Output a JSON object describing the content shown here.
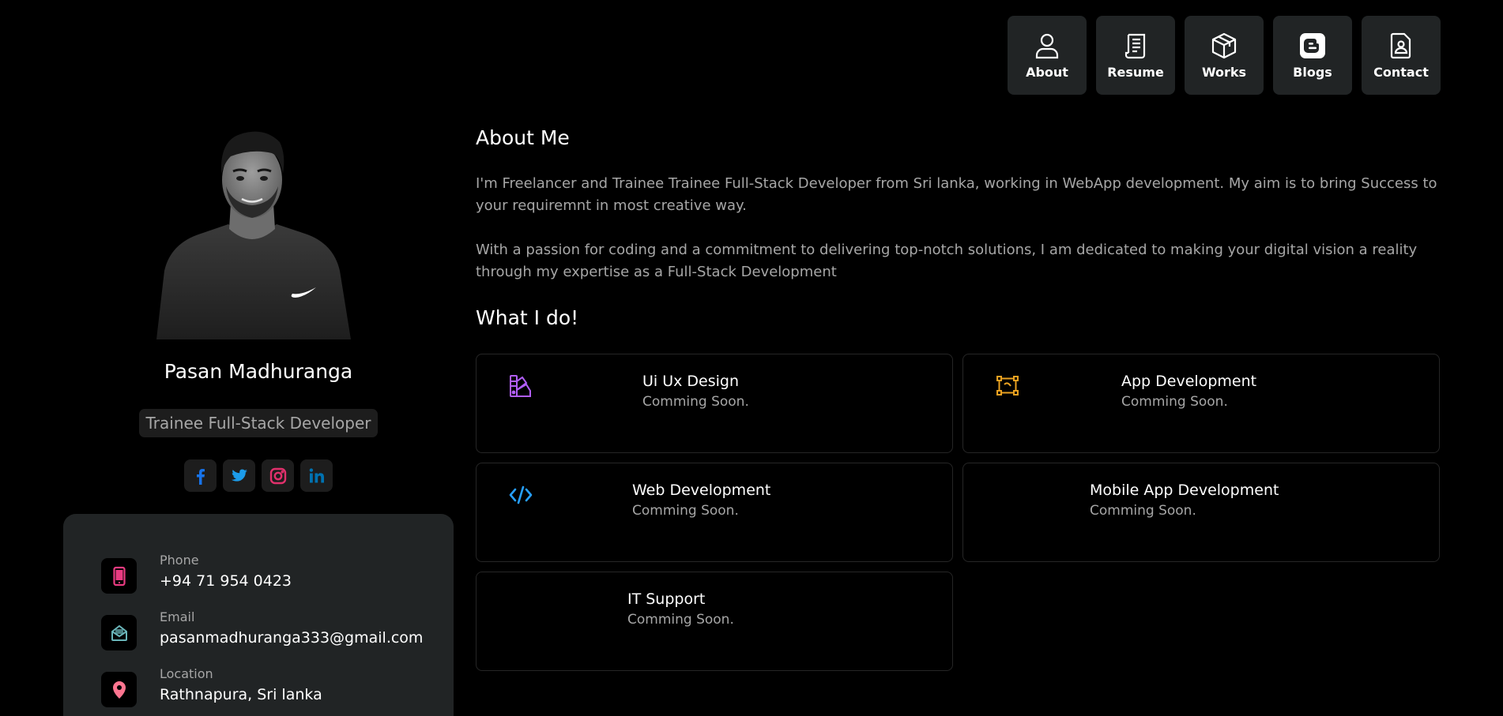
{
  "nav": [
    {
      "label": "About",
      "icon": "user-icon"
    },
    {
      "label": "Resume",
      "icon": "resume-icon"
    },
    {
      "label": "Works",
      "icon": "box-icon"
    },
    {
      "label": "Blogs",
      "icon": "blogger-icon"
    },
    {
      "label": "Contact",
      "icon": "contact-card-icon"
    }
  ],
  "profile": {
    "name": "Pasan Madhuranga",
    "role": "Trainee Full-Stack Developer",
    "socials": [
      {
        "icon": "facebook-icon",
        "color": "#1773ea"
      },
      {
        "icon": "twitter-icon",
        "color": "#1c9cea"
      },
      {
        "icon": "instagram-icon",
        "color": "#e1306c"
      },
      {
        "icon": "linkedin-icon",
        "color": "#0072b1"
      }
    ]
  },
  "contact": [
    {
      "label": "Phone",
      "value": "+94 71 954 0423",
      "icon": "phone-icon",
      "color": "#e93b81"
    },
    {
      "label": "Email",
      "value": "pasanmadhuranga333@gmail.com",
      "icon": "mail-open-icon",
      "color": "#6ab5b9"
    },
    {
      "label": "Location",
      "value": "Rathnapura, Sri lanka",
      "icon": "location-pin-icon",
      "color": "#fd7590"
    }
  ],
  "about": {
    "heading": "About Me",
    "para1": "I'm Freelancer and Trainee Trainee Full-Stack Developer from Sri lanka, working in WebApp development. My aim is to bring Success to your requiremnt in most creative way.",
    "para2": "With a passion for coding and a commitment to delivering top-notch solutions, I am dedicated to making your digital vision a reality through my expertise as a Full-Stack Development"
  },
  "services": {
    "heading": "What I do!",
    "items": [
      {
        "title": "Ui Ux Design",
        "desc": "Comming Soon.",
        "icon": "design-swatch-icon",
        "color": "#b15ef7"
      },
      {
        "title": "App Development",
        "desc": "Comming Soon.",
        "icon": "vector-nodes-icon",
        "color": "#e9a121"
      },
      {
        "title": "Web Development",
        "desc": "Comming Soon.",
        "icon": "code-icon",
        "color": "#269fff"
      },
      {
        "title": "Mobile App Development",
        "desc": "Comming Soon.",
        "icon": "",
        "color": ""
      },
      {
        "title": "IT Support",
        "desc": "Comming Soon.",
        "icon": "",
        "color": ""
      }
    ]
  }
}
